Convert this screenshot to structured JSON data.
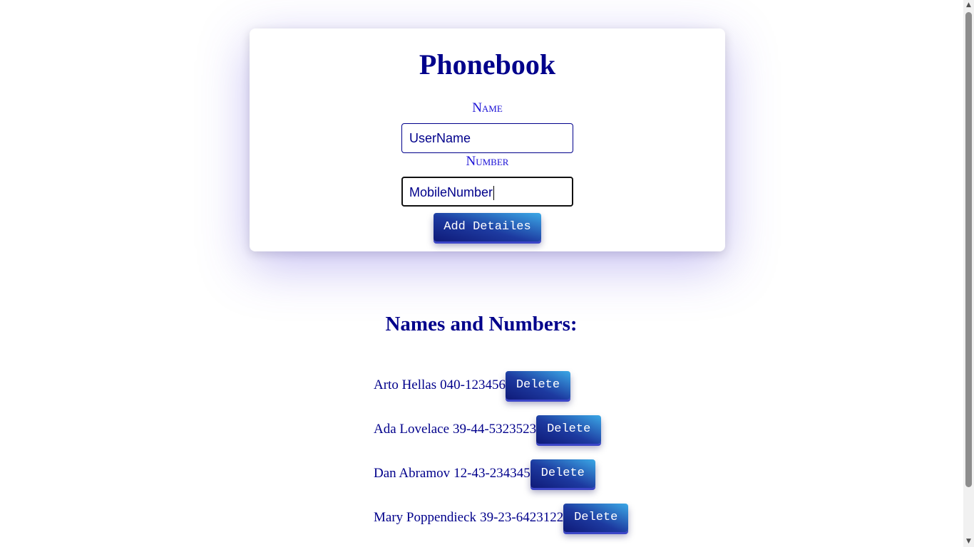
{
  "form": {
    "title": "Phonebook",
    "name_label": "Name",
    "name_value": "UserName",
    "number_label": "Number",
    "number_value": "MobileNumber",
    "add_button_label": "Add Detailes"
  },
  "list": {
    "heading": "Names and Numbers:",
    "delete_label": "Delete",
    "entries": [
      {
        "name": "Arto Hellas",
        "number": "040-123456"
      },
      {
        "name": "Ada Lovelace",
        "number": "39-44-5323523"
      },
      {
        "name": "Dan Abramov",
        "number": "12-43-234345"
      },
      {
        "name": "Mary Poppendieck",
        "number": "39-23-6423122"
      }
    ]
  },
  "scrollbar": {
    "up_icon": "arrow-up-icon",
    "down_icon": "arrow-down-icon"
  },
  "colors": {
    "primary_text": "#00008b",
    "label_text": "#1a10d6",
    "button_gradient_start": "#0f1a78",
    "button_gradient_end": "#3ba8e6"
  }
}
